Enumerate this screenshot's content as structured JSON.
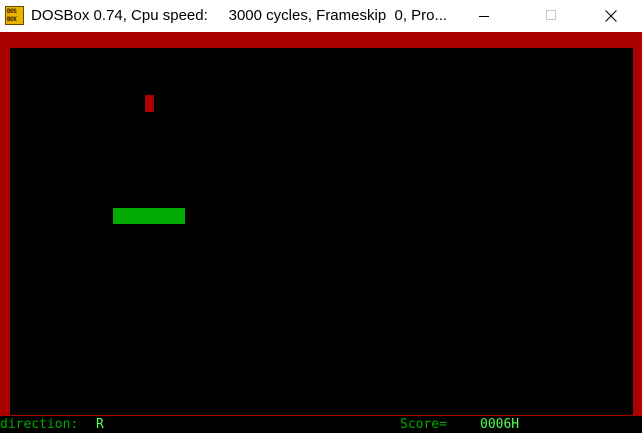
{
  "window": {
    "title": "DOSBox 0.74, Cpu speed:     3000 cycles, Frameskip  0, Pro...",
    "icon_line1": "DOS",
    "icon_line2": "BOX",
    "controls": [
      "minimize-icon",
      "maximize-icon",
      "close-icon"
    ]
  },
  "game": {
    "border_color": "#aa0000",
    "background_color": "#000000",
    "snake_color": "#00aa00",
    "food_color": "#aa0000"
  },
  "status": {
    "direction_label": "direction:",
    "direction_value": "R",
    "score_label": "Score=",
    "score_value": "0006H"
  }
}
